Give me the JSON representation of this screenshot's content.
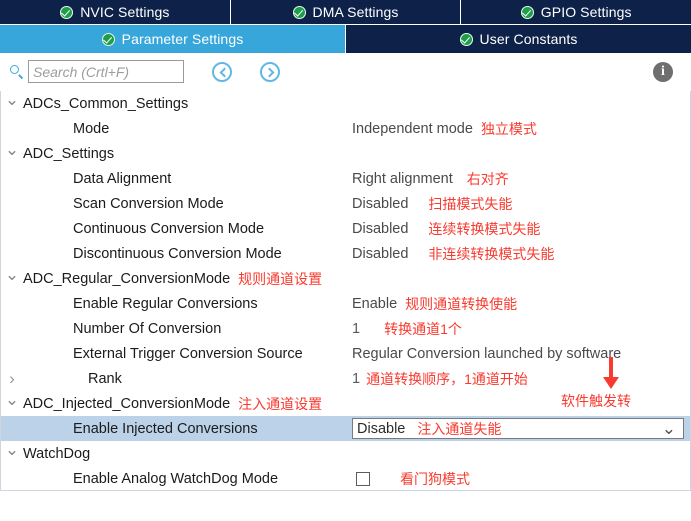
{
  "tabs": {
    "top": [
      {
        "label": "NVIC Settings",
        "icon": "check-badge-icon",
        "active": false
      },
      {
        "label": "DMA Settings",
        "icon": "check-badge-icon",
        "active": false
      },
      {
        "label": "GPIO Settings",
        "icon": "check-badge-icon",
        "active": false
      }
    ],
    "second": [
      {
        "label": "Parameter Settings",
        "icon": "check-badge-icon",
        "active": true
      },
      {
        "label": "User Constants",
        "icon": "check-badge-icon",
        "active": false
      }
    ]
  },
  "toolbar": {
    "search_placeholder": "Search (Crtl+F)",
    "search_value": "",
    "search_icon": "search-icon",
    "back_icon": "circle-left-arrow-icon",
    "forward_icon": "circle-right-arrow-icon",
    "info_icon": "info-icon",
    "info_glyph": "i"
  },
  "colors": {
    "tab_bar": "#0d2149",
    "active_tab": "#37a6db",
    "annotation_red": "#f93a2f",
    "selection": "#bcd2e8",
    "accent_blue": "#3fa9dd"
  },
  "tree": [
    {
      "name": "adcs-common-settings",
      "twisty": "open",
      "label": "ADCs_Common_Settings",
      "level": "group",
      "note": "",
      "value": "",
      "value_note": ""
    },
    {
      "name": "mode",
      "twisty": "blank",
      "label": "Mode",
      "level": "child",
      "note": "",
      "value": "Independent mode",
      "value_note": "独立模式"
    },
    {
      "name": "adc-settings",
      "twisty": "open",
      "label": "ADC_Settings",
      "level": "group",
      "note": "",
      "value": "",
      "value_note": ""
    },
    {
      "name": "data-alignment",
      "twisty": "blank",
      "label": "Data Alignment",
      "level": "child",
      "note": "",
      "value": "Right alignment",
      "value_note": "右对齐"
    },
    {
      "name": "scan-conversion-mode",
      "twisty": "blank",
      "label": "Scan Conversion Mode",
      "level": "child",
      "note": "",
      "value": "Disabled",
      "value_note": "扫描模式失能"
    },
    {
      "name": "continuous-conversion-mode",
      "twisty": "blank",
      "label": "Continuous Conversion Mode",
      "level": "child",
      "note": "",
      "value": "Disabled",
      "value_note": "连续转换模式失能"
    },
    {
      "name": "discontinuous-conversion-mode",
      "twisty": "blank",
      "label": "Discontinuous Conversion Mode",
      "level": "child",
      "note": "",
      "value": "Disabled",
      "value_note": "非连续转换模式失能"
    },
    {
      "name": "adc-regular-conversionmode",
      "twisty": "open",
      "label": "ADC_Regular_ConversionMode",
      "level": "group",
      "note": "规则通道设置",
      "value": "",
      "value_note": ""
    },
    {
      "name": "enable-regular-conversions",
      "twisty": "blank",
      "label": "Enable Regular Conversions",
      "level": "child",
      "note": "",
      "value": "Enable",
      "value_note": "规则通道转换使能"
    },
    {
      "name": "number-of-conversion",
      "twisty": "blank",
      "label": "Number Of Conversion",
      "level": "child",
      "note": "",
      "value": "1",
      "value_note": "转换通道1个"
    },
    {
      "name": "external-trigger-conversion-source",
      "twisty": "blank",
      "label": "External Trigger Conversion Source",
      "level": "child",
      "note": "",
      "value": "Regular Conversion launched by software",
      "value_note": ""
    },
    {
      "name": "rank",
      "twisty": "closed",
      "label": "Rank",
      "level": "child2",
      "note": "",
      "value": "1",
      "value_note": "通道转换顺序，1通道开始"
    },
    {
      "name": "adc-injected-conversionmode",
      "twisty": "open",
      "label": "ADC_Injected_ConversionMode",
      "level": "group",
      "note": "注入通道设置",
      "value": "",
      "value_note": ""
    },
    {
      "name": "enable-injected-conversions",
      "twisty": "blank",
      "label": "Enable Injected Conversions",
      "level": "child",
      "note": "",
      "value": "Disable",
      "value_note": "注入通道失能"
    },
    {
      "name": "watchdog",
      "twisty": "open",
      "label": "WatchDog",
      "level": "group",
      "note": "",
      "value": "",
      "value_note": ""
    },
    {
      "name": "enable-analog-watchdog-mode",
      "twisty": "blank",
      "label": "Enable Analog WatchDog Mode",
      "level": "child",
      "note": "",
      "value": "",
      "value_note": "看门狗模式"
    }
  ],
  "annotations": {
    "software_trigger_note": "软件触发转",
    "arrow_icon": "down-arrow-annotation-icon"
  }
}
